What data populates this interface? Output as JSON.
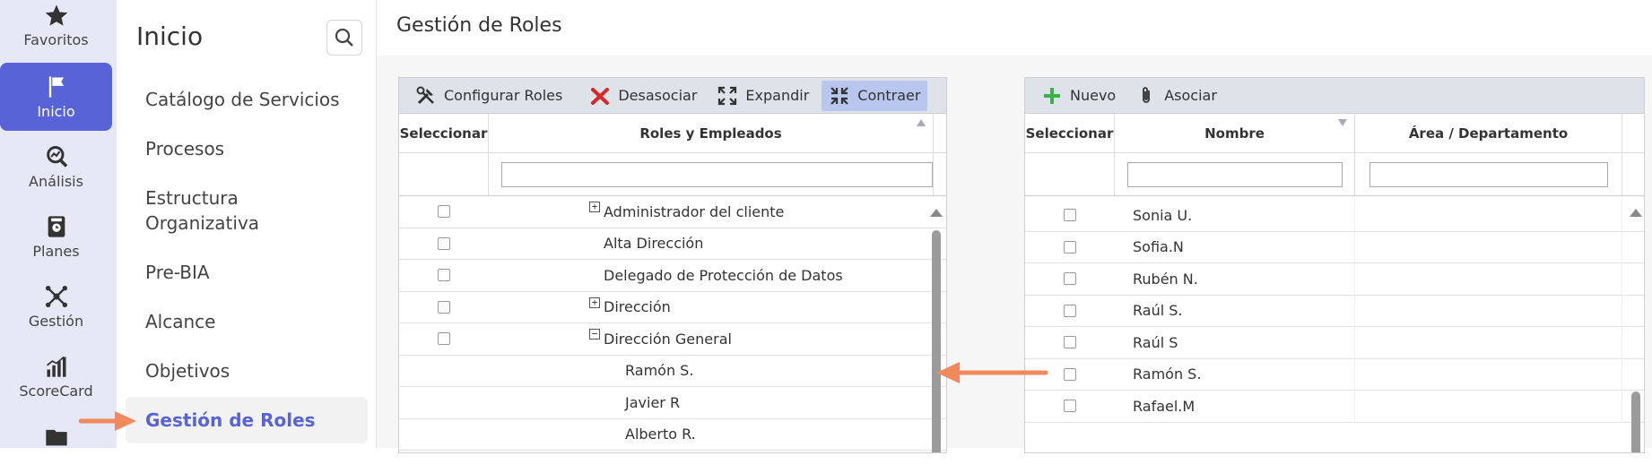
{
  "rail": {
    "items": [
      {
        "label": "Favoritos",
        "icon": "star-icon"
      },
      {
        "label": "Inicio",
        "icon": "flag-icon"
      },
      {
        "label": "Análisis",
        "icon": "analysis-icon"
      },
      {
        "label": "Planes",
        "icon": "plans-icon"
      },
      {
        "label": "Gestión",
        "icon": "network-icon"
      },
      {
        "label": "ScoreCard",
        "icon": "bar-chart-icon"
      },
      {
        "label": "",
        "icon": "folder-icon"
      }
    ]
  },
  "nav": {
    "title": "Inicio",
    "items": [
      {
        "label": "Catálogo de Servicios"
      },
      {
        "label": "Procesos"
      },
      {
        "label": "Estructura Organizativa"
      },
      {
        "label": "Pre-BIA"
      },
      {
        "label": "Alcance"
      },
      {
        "label": "Objetivos"
      },
      {
        "label": "Gestión de Roles"
      }
    ]
  },
  "main": {
    "title": "Gestión de Roles"
  },
  "left_panel": {
    "toolbar": {
      "configure": "Configurar Roles",
      "disassociate": "Desasociar",
      "expand": "Expandir",
      "collapse": "Contraer"
    },
    "columns": {
      "select": "Seleccionar",
      "roles": "Roles y Empleados"
    },
    "rows": [
      {
        "label": "Administrador del cliente",
        "expander": "+",
        "checkbox": true
      },
      {
        "label": "Alta Dirección",
        "expander": "",
        "checkbox": true
      },
      {
        "label": "Delegado de Protección de Datos",
        "expander": "",
        "checkbox": true
      },
      {
        "label": "Dirección",
        "expander": "+",
        "checkbox": true
      },
      {
        "label": "Dirección General",
        "expander": "−",
        "checkbox": true
      },
      {
        "label": "Ramón S.",
        "expander": "",
        "checkbox": false
      },
      {
        "label": "Javier R",
        "expander": "",
        "checkbox": false
      },
      {
        "label": "Alberto R.",
        "expander": "",
        "checkbox": false
      }
    ]
  },
  "right_panel": {
    "toolbar": {
      "new": "Nuevo",
      "associate": "Asociar"
    },
    "columns": {
      "select": "Seleccionar",
      "name": "Nombre",
      "area": "Área / Departamento"
    },
    "rows": [
      {
        "name": "Sonia U."
      },
      {
        "name": "Sofia.N"
      },
      {
        "name": "Rubén N."
      },
      {
        "name": "Raúl S."
      },
      {
        "name": "Raúl S"
      },
      {
        "name": "Ramón S."
      },
      {
        "name": "Rafael.M"
      }
    ]
  },
  "colors": {
    "accent": "#5763d6",
    "arrow": "#f08a5d",
    "toolbar_bg": "#dde3e9",
    "rail_bg": "#e6e8f5"
  }
}
